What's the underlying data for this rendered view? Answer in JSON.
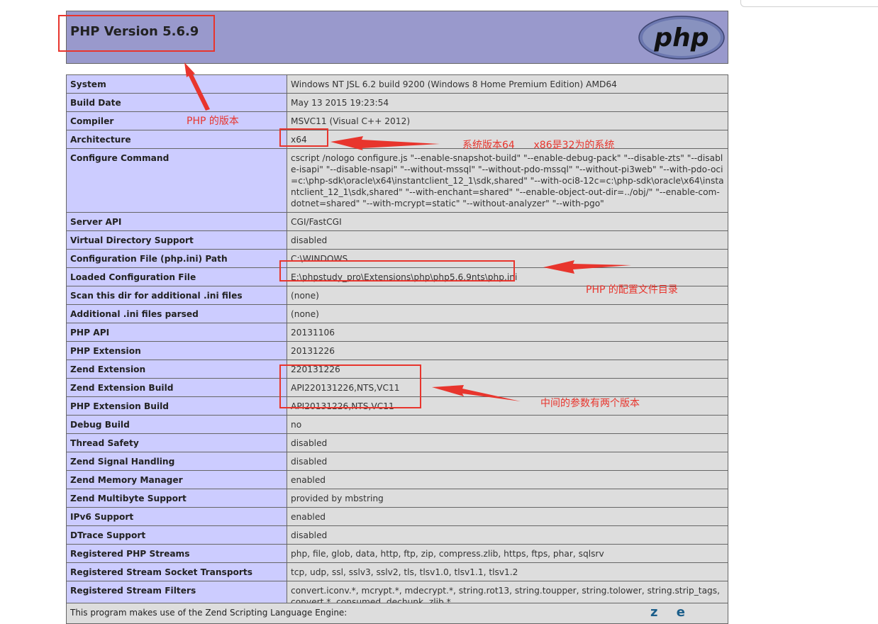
{
  "header": {
    "title": "PHP Version 5.6.9",
    "logo": "php"
  },
  "rows": [
    {
      "key": "System",
      "value": "Windows NT JSL 6.2 build 9200 (Windows 8 Home Premium Edition) AMD64"
    },
    {
      "key": "Build Date",
      "value": "May 13 2015 19:23:54"
    },
    {
      "key": "Compiler",
      "value": "MSVC11 (Visual C++ 2012)"
    },
    {
      "key": "Architecture",
      "value": "x64"
    },
    {
      "key": "Configure Command",
      "value": "cscript /nologo configure.js \"--enable-snapshot-build\" \"--enable-debug-pack\" \"--disable-zts\" \"--disable-isapi\" \"--disable-nsapi\" \"--without-mssql\" \"--without-pdo-mssql\" \"--without-pi3web\" \"--with-pdo-oci=c:\\php-sdk\\oracle\\x64\\instantclient_12_1\\sdk,shared\" \"--with-oci8-12c=c:\\php-sdk\\oracle\\x64\\instantclient_12_1\\sdk,shared\" \"--with-enchant=shared\" \"--enable-object-out-dir=../obj/\" \"--enable-com-dotnet=shared\" \"--with-mcrypt=static\" \"--without-analyzer\" \"--with-pgo\""
    },
    {
      "key": "Server API",
      "value": "CGI/FastCGI"
    },
    {
      "key": "Virtual Directory Support",
      "value": "disabled"
    },
    {
      "key": "Configuration File (php.ini) Path",
      "value": "C:\\WINDOWS"
    },
    {
      "key": "Loaded Configuration File",
      "value": "E:\\phpstudy_pro\\Extensions\\php\\php5.6.9nts\\php.ini"
    },
    {
      "key": "Scan this dir for additional .ini files",
      "value": "(none)"
    },
    {
      "key": "Additional .ini files parsed",
      "value": "(none)"
    },
    {
      "key": "PHP API",
      "value": "20131106"
    },
    {
      "key": "PHP Extension",
      "value": "20131226"
    },
    {
      "key": "Zend Extension",
      "value": "220131226"
    },
    {
      "key": "Zend Extension Build",
      "value": "API220131226,NTS,VC11"
    },
    {
      "key": "PHP Extension Build",
      "value": "API20131226,NTS,VC11"
    },
    {
      "key": "Debug Build",
      "value": "no"
    },
    {
      "key": "Thread Safety",
      "value": "disabled"
    },
    {
      "key": "Zend Signal Handling",
      "value": "disabled"
    },
    {
      "key": "Zend Memory Manager",
      "value": "enabled"
    },
    {
      "key": "Zend Multibyte Support",
      "value": "provided by mbstring"
    },
    {
      "key": "IPv6 Support",
      "value": "enabled"
    },
    {
      "key": "DTrace Support",
      "value": "disabled"
    },
    {
      "key": "Registered PHP Streams",
      "value": "php, file, glob, data, http, ftp, zip, compress.zlib, https, ftps, phar, sqlsrv"
    },
    {
      "key": "Registered Stream Socket Transports",
      "value": "tcp, udp, ssl, sslv3, sslv2, tls, tlsv1.0, tlsv1.1, tlsv1.2"
    },
    {
      "key": "Registered Stream Filters",
      "value": "convert.iconv.*, mcrypt.*, mdecrypt.*, string.rot13, string.toupper, string.tolower, string.strip_tags, convert.*, consumed, dechunk, zlib.*"
    }
  ],
  "footer": {
    "text": "This program makes use of the Zend Scripting Language Engine:",
    "logo": "zend"
  },
  "annotations": {
    "version_note": "PHP 的版本",
    "arch_note": "系统版本64      x86是32为的系统",
    "config_note": "PHP 的配置文件目录",
    "build_note": "中间的参数有两个版本",
    "color": "#e8352d"
  },
  "colors": {
    "header_bg": "#9999cc",
    "key_bg": "#ccccff",
    "value_bg": "#dddddd"
  }
}
